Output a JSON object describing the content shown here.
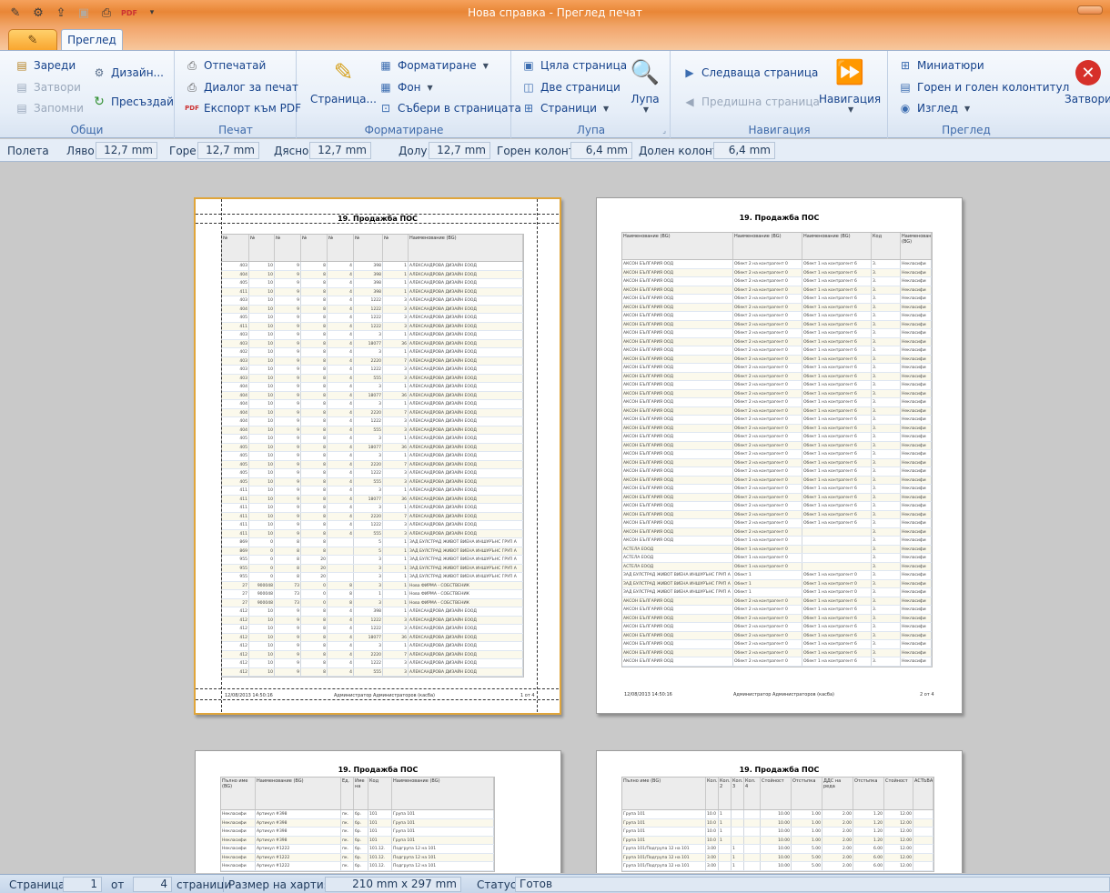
{
  "window": {
    "title": "Нова справка - Преглед печат"
  },
  "qat": [
    "edit-icon",
    "gear-icon",
    "export-icon",
    "save-icon",
    "print-icon",
    "pdf-icon",
    "customize-icon"
  ],
  "tabs": {
    "active": "Преглед"
  },
  "ribbon": {
    "general": {
      "label": "Общи",
      "load": "Зареди",
      "close": "Затвори",
      "save": "Запомни",
      "design": "Дизайн...",
      "recreate": "Пресъздай"
    },
    "print": {
      "label": "Печат",
      "print": "Отпечатай",
      "dialog": "Диалог за печат",
      "export_pdf": "Експорт към PDF"
    },
    "format": {
      "label": "Форматиране",
      "page": "Страница...",
      "formatting": "Форматиране",
      "background": "Фон",
      "fit": "Събери в страницата"
    },
    "zoom": {
      "label": "Лупа",
      "whole_page": "Цяла страница",
      "two_pages": "Две страници",
      "pages": "Страници",
      "zoom": "Лупа"
    },
    "navigation": {
      "label": "Навигация",
      "next": "Следваща страница",
      "prev": "Предишна страница",
      "nav": "Навигация"
    },
    "view": {
      "label": "Преглед",
      "thumbnails": "Миниатюри",
      "header_footer": "Горен и голен колонтитул",
      "view": "Изглед",
      "close": "Затвори"
    }
  },
  "margins": {
    "label": "Полета",
    "left_label": "Ляво:",
    "left": "12,7 mm",
    "top_label": "Горе:",
    "top": "12,7 mm",
    "right_label": "Дясно:",
    "right": "12,7 mm",
    "bottom_label": "Долу:",
    "bottom": "12,7 mm",
    "header_label": "Горен колонт.:",
    "header": "6,4 mm",
    "footer_label": "Долен колонт.:",
    "footer": "6,4 mm"
  },
  "report": {
    "title": "19. Продажба ПОС",
    "footer_date": "12/08/2013 14:50:16",
    "footer_user": "Администратор Администраторов (касба)",
    "page1": "1 от 4",
    "page2": "2 от 4",
    "p1_headers": [
      "№",
      "№",
      "№",
      "№",
      "№",
      "№",
      "№",
      "Наименование (BG)"
    ],
    "p1_rows": [
      [
        "403",
        "10",
        "9",
        "8",
        "4",
        "398",
        "1",
        "АЛЕКСАНДРОВА ДИЗАЙН ЕООД"
      ],
      [
        "404",
        "10",
        "9",
        "8",
        "4",
        "398",
        "1",
        "АЛЕКСАНДРОВА ДИЗАЙН ЕООД"
      ],
      [
        "405",
        "10",
        "9",
        "8",
        "4",
        "398",
        "1",
        "АЛЕКСАНДРОВА ДИЗАЙН ЕООД"
      ],
      [
        "411",
        "10",
        "9",
        "8",
        "4",
        "398",
        "1",
        "АЛЕКСАНДРОВА ДИЗАЙН ЕООД"
      ],
      [
        "403",
        "10",
        "9",
        "8",
        "4",
        "1222",
        "3",
        "АЛЕКСАНДРОВА ДИЗАЙН ЕООД"
      ],
      [
        "404",
        "10",
        "9",
        "8",
        "4",
        "1222",
        "3",
        "АЛЕКСАНДРОВА ДИЗАЙН ЕООД"
      ],
      [
        "405",
        "10",
        "9",
        "8",
        "4",
        "1222",
        "3",
        "АЛЕКСАНДРОВА ДИЗАЙН ЕООД"
      ],
      [
        "411",
        "10",
        "9",
        "8",
        "4",
        "1222",
        "3",
        "АЛЕКСАНДРОВА ДИЗАЙН ЕООД"
      ],
      [
        "403",
        "10",
        "9",
        "8",
        "4",
        "3",
        "1",
        "АЛЕКСАНДРОВА ДИЗАЙН ЕООД"
      ],
      [
        "403",
        "10",
        "9",
        "8",
        "4",
        "18077",
        "36",
        "АЛЕКСАНДРОВА ДИЗАЙН ЕООД"
      ],
      [
        "402",
        "10",
        "9",
        "8",
        "4",
        "3",
        "1",
        "АЛЕКСАНДРОВА ДИЗАЙН ЕООД"
      ],
      [
        "403",
        "10",
        "9",
        "8",
        "4",
        "2220",
        "7",
        "АЛЕКСАНДРОВА ДИЗАЙН ЕООД"
      ],
      [
        "403",
        "10",
        "9",
        "8",
        "4",
        "1222",
        "3",
        "АЛЕКСАНДРОВА ДИЗАЙН ЕООД"
      ],
      [
        "403",
        "10",
        "9",
        "8",
        "4",
        "555",
        "3",
        "АЛЕКСАНДРОВА ДИЗАЙН ЕООД"
      ],
      [
        "404",
        "10",
        "9",
        "8",
        "4",
        "3",
        "1",
        "АЛЕКСАНДРОВА ДИЗАЙН ЕООД"
      ],
      [
        "404",
        "10",
        "9",
        "8",
        "4",
        "18077",
        "36",
        "АЛЕКСАНДРОВА ДИЗАЙН ЕООД"
      ],
      [
        "404",
        "10",
        "9",
        "8",
        "4",
        "3",
        "1",
        "АЛЕКСАНДРОВА ДИЗАЙН ЕООД"
      ],
      [
        "404",
        "10",
        "9",
        "8",
        "4",
        "2220",
        "7",
        "АЛЕКСАНДРОВА ДИЗАЙН ЕООД"
      ],
      [
        "404",
        "10",
        "9",
        "8",
        "4",
        "1222",
        "3",
        "АЛЕКСАНДРОВА ДИЗАЙН ЕООД"
      ],
      [
        "404",
        "10",
        "9",
        "8",
        "4",
        "555",
        "3",
        "АЛЕКСАНДРОВА ДИЗАЙН ЕООД"
      ],
      [
        "405",
        "10",
        "9",
        "8",
        "4",
        "3",
        "1",
        "АЛЕКСАНДРОВА ДИЗАЙН ЕООД"
      ],
      [
        "405",
        "10",
        "9",
        "8",
        "4",
        "18077",
        "36",
        "АЛЕКСАНДРОВА ДИЗАЙН ЕООД"
      ],
      [
        "405",
        "10",
        "9",
        "8",
        "4",
        "3",
        "1",
        "АЛЕКСАНДРОВА ДИЗАЙН ЕООД"
      ],
      [
        "405",
        "10",
        "9",
        "8",
        "4",
        "2220",
        "7",
        "АЛЕКСАНДРОВА ДИЗАЙН ЕООД"
      ],
      [
        "405",
        "10",
        "9",
        "8",
        "4",
        "1222",
        "3",
        "АЛЕКСАНДРОВА ДИЗАЙН ЕООД"
      ],
      [
        "405",
        "10",
        "9",
        "8",
        "4",
        "555",
        "3",
        "АЛЕКСАНДРОВА ДИЗАЙН ЕООД"
      ],
      [
        "411",
        "10",
        "9",
        "8",
        "4",
        "3",
        "1",
        "АЛЕКСАНДРОВА ДИЗАЙН ЕООД"
      ],
      [
        "411",
        "10",
        "9",
        "8",
        "4",
        "18077",
        "36",
        "АЛЕКСАНДРОВА ДИЗАЙН ЕООД"
      ],
      [
        "411",
        "10",
        "9",
        "8",
        "4",
        "3",
        "1",
        "АЛЕКСАНДРОВА ДИЗАЙН ЕООД"
      ],
      [
        "411",
        "10",
        "9",
        "8",
        "4",
        "2220",
        "7",
        "АЛЕКСАНДРОВА ДИЗАЙН ЕООД"
      ],
      [
        "411",
        "10",
        "9",
        "8",
        "4",
        "1222",
        "3",
        "АЛЕКСАНДРОВА ДИЗАЙН ЕООД"
      ],
      [
        "411",
        "10",
        "9",
        "8",
        "4",
        "555",
        "3",
        "АЛЕКСАНДРОВА ДИЗАЙН ЕООД"
      ],
      [
        "869",
        "0",
        "8",
        "8",
        "",
        "5",
        "1",
        "ЗАД БУЛСТРАД ЖИВОТ ВИЕНА ИНШУРЪНС ГРУП А"
      ],
      [
        "869",
        "0",
        "8",
        "8",
        "",
        "5",
        "1",
        "ЗАД БУЛСТРАД ЖИВОТ ВИЕНА ИНШУРЪНС ГРУП А"
      ],
      [
        "955",
        "0",
        "8",
        "20",
        "",
        "3",
        "1",
        "ЗАД БУЛСТРАД ЖИВОТ ВИЕНА ИНШУРЪНС ГРУП А"
      ],
      [
        "955",
        "0",
        "8",
        "20",
        "",
        "3",
        "1",
        "ЗАД БУЛСТРАД ЖИВОТ ВИЕНА ИНШУРЪНС ГРУП А"
      ],
      [
        "955",
        "0",
        "8",
        "20",
        "",
        "3",
        "1",
        "ЗАД БУЛСТРАД ЖИВОТ ВИЕНА ИНШУРЪНС ГРУП А"
      ],
      [
        "27",
        "900048",
        "73",
        "0",
        "8",
        "3",
        "1",
        "Нова ФИРМА - СОБСТВЕНИК"
      ],
      [
        "27",
        "900048",
        "73",
        "0",
        "8",
        "1",
        "1",
        "Нова ФИРМА - СОБСТВЕНИК"
      ],
      [
        "27",
        "900048",
        "73",
        "0",
        "8",
        "3",
        "1",
        "Нова ФИРМА - СОБСТВЕНИК"
      ],
      [
        "412",
        "10",
        "9",
        "8",
        "4",
        "398",
        "1",
        "АЛЕКСАНДРОВА ДИЗАЙН ЕООД"
      ],
      [
        "412",
        "10",
        "9",
        "8",
        "4",
        "1222",
        "3",
        "АЛЕКСАНДРОВА ДИЗАЙН ЕООД"
      ],
      [
        "412",
        "10",
        "9",
        "8",
        "4",
        "1222",
        "3",
        "АЛЕКСАНДРОВА ДИЗАЙН ЕООД"
      ],
      [
        "412",
        "10",
        "9",
        "8",
        "4",
        "18077",
        "36",
        "АЛЕКСАНДРОВА ДИЗАЙН ЕООД"
      ],
      [
        "412",
        "10",
        "9",
        "8",
        "4",
        "3",
        "1",
        "АЛЕКСАНДРОВА ДИЗАЙН ЕООД"
      ],
      [
        "412",
        "10",
        "9",
        "8",
        "4",
        "2220",
        "7",
        "АЛЕКСАНДРОВА ДИЗАЙН ЕООД"
      ],
      [
        "412",
        "10",
        "9",
        "8",
        "4",
        "1222",
        "3",
        "АЛЕКСАНДРОВА ДИЗАЙН ЕООД"
      ],
      [
        "412",
        "10",
        "9",
        "8",
        "4",
        "555",
        "3",
        "АЛЕКСАНДРОВА ДИЗАЙН ЕООД"
      ]
    ],
    "p2_headers": [
      "Наименование (BG)",
      "Наименование (BG)",
      "Наименование (BG)",
      "Код",
      "Наименование (BG)"
    ],
    "p2_rows": [
      [
        "АКСОН БЪЛГАРИЯ ООД",
        "Обект 2 на контрагент 0",
        "Обект 1 на контрагент 6",
        "3.",
        "Некласифи"
      ],
      [
        "АКСОН БЪЛГАРИЯ ООД",
        "Обект 2 на контрагент 0",
        "Обект 1 на контрагент 6",
        "3.",
        "Некласифи"
      ],
      [
        "АКСОН БЪЛГАРИЯ ООД",
        "Обект 2 на контрагент 0",
        "Обект 1 на контрагент 6",
        "3.",
        "Некласифи"
      ],
      [
        "АКСОН БЪЛГАРИЯ ООД",
        "Обект 2 на контрагент 0",
        "Обект 1 на контрагент 6",
        "3.",
        "Некласифи"
      ],
      [
        "АКСОН БЪЛГАРИЯ ООД",
        "Обект 2 на контрагент 0",
        "Обект 1 на контрагент 6",
        "3.",
        "Некласифи"
      ],
      [
        "АКСОН БЪЛГАРИЯ ООД",
        "Обект 2 на контрагент 0",
        "Обект 1 на контрагент 6",
        "3.",
        "Некласифи"
      ],
      [
        "АКСОН БЪЛГАРИЯ ООД",
        "Обект 2 на контрагент 0",
        "Обект 1 на контрагент 6",
        "3.",
        "Некласифи"
      ],
      [
        "АКСОН БЪЛГАРИЯ ООД",
        "Обект 2 на контрагент 0",
        "Обект 1 на контрагент 6",
        "3.",
        "Некласифи"
      ],
      [
        "АКСОН БЪЛГАРИЯ ООД",
        "Обект 2 на контрагент 0",
        "Обект 1 на контрагент 6",
        "3.",
        "Некласифи"
      ],
      [
        "АКСОН БЪЛГАРИЯ ООД",
        "Обект 2 на контрагент 0",
        "Обект 1 на контрагент 6",
        "3.",
        "Некласифи"
      ],
      [
        "АКСОН БЪЛГАРИЯ ООД",
        "Обект 2 на контрагент 0",
        "Обект 1 на контрагент 6",
        "3.",
        "Некласифи"
      ],
      [
        "АКСОН БЪЛГАРИЯ ООД",
        "Обект 2 на контрагент 0",
        "Обект 1 на контрагент 6",
        "3.",
        "Некласифи"
      ],
      [
        "АКСОН БЪЛГАРИЯ ООД",
        "Обект 2 на контрагент 0",
        "Обект 1 на контрагент 6",
        "3.",
        "Некласифи"
      ],
      [
        "АКСОН БЪЛГАРИЯ ООД",
        "Обект 2 на контрагент 0",
        "Обект 1 на контрагент 6",
        "3.",
        "Некласифи"
      ],
      [
        "АКСОН БЪЛГАРИЯ ООД",
        "Обект 2 на контрагент 0",
        "Обект 1 на контрагент 6",
        "3.",
        "Некласифи"
      ],
      [
        "АКСОН БЪЛГАРИЯ ООД",
        "Обект 2 на контрагент 0",
        "Обект 1 на контрагент 6",
        "3.",
        "Некласифи"
      ],
      [
        "АКСОН БЪЛГАРИЯ ООД",
        "Обект 2 на контрагент 0",
        "Обект 1 на контрагент 6",
        "3.",
        "Некласифи"
      ],
      [
        "АКСОН БЪЛГАРИЯ ООД",
        "Обект 2 на контрагент 0",
        "Обект 1 на контрагент 6",
        "3.",
        "Некласифи"
      ],
      [
        "АКСОН БЪЛГАРИЯ ООД",
        "Обект 2 на контрагент 0",
        "Обект 1 на контрагент 6",
        "3.",
        "Некласифи"
      ],
      [
        "АКСОН БЪЛГАРИЯ ООД",
        "Обект 2 на контрагент 0",
        "Обект 1 на контрагент 6",
        "3.",
        "Некласифи"
      ],
      [
        "АКСОН БЪЛГАРИЯ ООД",
        "Обект 2 на контрагент 0",
        "Обект 1 на контрагент 6",
        "3.",
        "Некласифи"
      ],
      [
        "АКСОН БЪЛГАРИЯ ООД",
        "Обект 2 на контрагент 0",
        "Обект 1 на контрагент 6",
        "3.",
        "Некласифи"
      ],
      [
        "АКСОН БЪЛГАРИЯ ООД",
        "Обект 2 на контрагент 0",
        "Обект 1 на контрагент 6",
        "3.",
        "Некласифи"
      ],
      [
        "АКСОН БЪЛГАРИЯ ООД",
        "Обект 2 на контрагент 0",
        "Обект 1 на контрагент 6",
        "3.",
        "Некласифи"
      ],
      [
        "АКСОН БЪЛГАРИЯ ООД",
        "Обект 2 на контрагент 0",
        "Обект 1 на контрагент 6",
        "3.",
        "Некласифи"
      ],
      [
        "АКСОН БЪЛГАРИЯ ООД",
        "Обект 2 на контрагент 0",
        "Обект 1 на контрагент 6",
        "3.",
        "Некласифи"
      ],
      [
        "АКСОН БЪЛГАРИЯ ООД",
        "Обект 2 на контрагент 0",
        "Обект 1 на контрагент 6",
        "3.",
        "Некласифи"
      ],
      [
        "АКСОН БЪЛГАРИЯ ООД",
        "Обект 2 на контрагент 0",
        "Обект 1 на контрагент 6",
        "3.",
        "Некласифи"
      ],
      [
        "АКСОН БЪЛГАРИЯ ООД",
        "Обект 2 на контрагент 0",
        "Обект 1 на контрагент 6",
        "3.",
        "Некласифи"
      ],
      [
        "АКСОН БЪЛГАРИЯ ООД",
        "Обект 2 на контрагент 0",
        "Обект 1 на контрагент 6",
        "3.",
        "Некласифи"
      ],
      [
        "АКСОН БЪЛГАРИЯ ООД",
        "Обект 2 на контрагент 0",
        "Обект 1 на контрагент 6",
        "3.",
        "Некласифи"
      ],
      [
        "АКСОН БЪЛГАРИЯ ООД",
        "Обект 2 на контрагент 0",
        "",
        "3.",
        "Некласифи"
      ],
      [
        "АКСОН БЪЛГАРИЯ ООД",
        "Обект 1 на контрагент 0",
        "",
        "3.",
        "Некласифи"
      ],
      [
        "АСТЕЛА ЕООД",
        "Обект 1 на контрагент 0",
        "",
        "3.",
        "Некласифи"
      ],
      [
        "АСТЕЛА ЕООД",
        "Обект 1 на контрагент 0",
        "",
        "3.",
        "Некласифи"
      ],
      [
        "АСТЕЛА ЕООД",
        "Обект 1 на контрагент 0",
        "",
        "3.",
        "Некласифи"
      ],
      [
        "ЗАД БУЛСТРАД ЖИВОТ ВИЕНА ИНШУРЪНС ГРУП А",
        "Обект 1",
        "Обект 1 на контрагент 0",
        "3.",
        "Некласифи"
      ],
      [
        "ЗАД БУЛСТРАД ЖИВОТ ВИЕНА ИНШУРЪНС ГРУП А",
        "Обект 1",
        "Обект 1 на контрагент 0",
        "3.",
        "Некласифи"
      ],
      [
        "ЗАД БУЛСТРАД ЖИВОТ ВИЕНА ИНШУРЪНС ГРУП А",
        "Обект 1",
        "Обект 1 на контрагент 0",
        "3.",
        "Некласифи"
      ],
      [
        "АКСОН БЪЛГАРИЯ ООД",
        "Обект 2 на контрагент 0",
        "Обект 1 на контрагент 6",
        "3.",
        "Некласифи"
      ],
      [
        "АКСОН БЪЛГАРИЯ ООД",
        "Обект 2 на контрагент 0",
        "Обект 1 на контрагент 6",
        "3.",
        "Некласифи"
      ],
      [
        "АКСОН БЪЛГАРИЯ ООД",
        "Обект 2 на контрагент 0",
        "Обект 1 на контрагент 6",
        "3.",
        "Некласифи"
      ],
      [
        "АКСОН БЪЛГАРИЯ ООД",
        "Обект 2 на контрагент 0",
        "Обект 1 на контрагент 6",
        "3.",
        "Некласифи"
      ],
      [
        "АКСОН БЪЛГАРИЯ ООД",
        "Обект 2 на контрагент 0",
        "Обект 1 на контрагент 6",
        "3.",
        "Некласифи"
      ],
      [
        "АКСОН БЪЛГАРИЯ ООД",
        "Обект 2 на контрагент 0",
        "Обект 1 на контрагент 6",
        "3.",
        "Некласифи"
      ],
      [
        "АКСОН БЪЛГАРИЯ ООД",
        "Обект 2 на контрагент 0",
        "Обект 1 на контрагент 6",
        "3.",
        "Некласифи"
      ],
      [
        "АКСОН БЪЛГАРИЯ ООД",
        "Обект 2 на контрагент 0",
        "Обект 1 на контрагент 6",
        "3.",
        "Некласифи"
      ]
    ],
    "p3_headers": [
      "Пълно име (BG)",
      "Наименование (BG)",
      "Ед.",
      "Име на",
      "Код",
      "Наименование (BG)"
    ],
    "p3_rows": [
      [
        "Некласифи",
        "Артикул #398",
        "пк.",
        "бр.",
        "101",
        "Група 101"
      ],
      [
        "Некласифи",
        "Артикул #398",
        "пк.",
        "бр.",
        "101",
        "Група 101"
      ],
      [
        "Некласифи",
        "Артикул #398",
        "пк.",
        "бр.",
        "101",
        "Група 101"
      ],
      [
        "Некласифи",
        "Артикул #398",
        "пк.",
        "бр.",
        "101",
        "Група 101"
      ],
      [
        "Некласифи",
        "Артикул #1222",
        "пк.",
        "бр.",
        "101.12.",
        "Подгрупа 12 на 101"
      ],
      [
        "Некласифи",
        "Артикул #1222",
        "пк.",
        "бр.",
        "101.12.",
        "Подгрупа 12 на 101"
      ],
      [
        "Некласифи",
        "Артикул #1222",
        "пк.",
        "бр.",
        "101.12.",
        "Подгрупа 12 на 101"
      ]
    ],
    "p4_headers": [
      "Пълно име (BG)",
      "Кол.",
      "Кол. 2",
      "Кол. 3",
      "Кол. 4",
      "Стойност",
      "Отстъпка",
      "ДДС на реда",
      "Отстъпка",
      "Стойност",
      "АСТЬВА"
    ],
    "p4_rows": [
      [
        "Група 101",
        "10.0",
        "1",
        "",
        "",
        "10.00",
        "1.00",
        "2.00",
        "1.20",
        "12.00",
        ""
      ],
      [
        "Група 101",
        "10.0",
        "1",
        "",
        "",
        "10.00",
        "1.00",
        "2.00",
        "1.20",
        "12.00",
        ""
      ],
      [
        "Група 101",
        "10.0",
        "1",
        "",
        "",
        "10.00",
        "1.00",
        "2.00",
        "1.20",
        "12.00",
        ""
      ],
      [
        "Група 101",
        "10.0",
        "1",
        "",
        "",
        "10.00",
        "1.00",
        "2.00",
        "1.20",
        "12.00",
        ""
      ],
      [
        "Група 101/Подгрупа 12 на 101",
        "3.00",
        "",
        "1",
        "",
        "10.00",
        "5.00",
        "2.00",
        "6.00",
        "12.00",
        ""
      ],
      [
        "Група 101/Подгрупа 12 на 101",
        "3.00",
        "",
        "1",
        "",
        "10.00",
        "5.00",
        "2.00",
        "6.00",
        "12.00",
        ""
      ],
      [
        "Група 101/Подгрупа 12 на 101",
        "3.00",
        "",
        "1",
        "",
        "10.00",
        "5.00",
        "2.00",
        "6.00",
        "12.00",
        ""
      ]
    ]
  },
  "status": {
    "page_label": "Страница:",
    "page": "1",
    "of_label": "от",
    "total": "4",
    "pages_label": "страници",
    "paper_label": "Размер на хартията",
    "paper": "210 mm x 297 mm",
    "status_label": "Статус:",
    "status": "Готов"
  }
}
